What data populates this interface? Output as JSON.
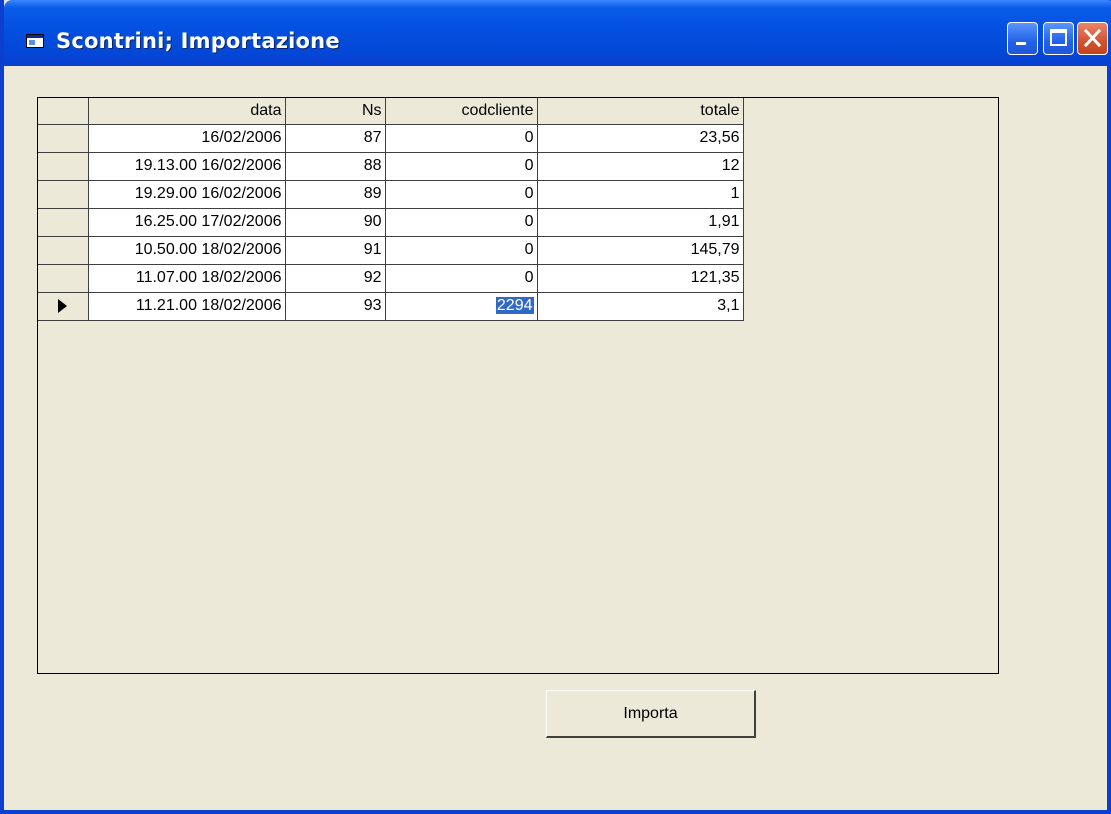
{
  "window": {
    "title": "Scontrini; Importazione"
  },
  "grid": {
    "columns": [
      "",
      "data",
      "Ns",
      "codcliente",
      "totale"
    ],
    "rows": [
      {
        "data": "16/02/2006",
        "ns": "87",
        "codcliente": "0",
        "totale": "23,56",
        "current": false
      },
      {
        "data": "16/02/2006 19.13.00",
        "ns": "88",
        "codcliente": "0",
        "totale": "12",
        "current": false
      },
      {
        "data": "16/02/2006 19.29.00",
        "ns": "89",
        "codcliente": "0",
        "totale": "1",
        "current": false
      },
      {
        "data": "17/02/2006 16.25.00",
        "ns": "90",
        "codcliente": "0",
        "totale": "1,91",
        "current": false
      },
      {
        "data": "18/02/2006 10.50.00",
        "ns": "91",
        "codcliente": "0",
        "totale": "145,79",
        "current": false
      },
      {
        "data": "18/02/2006 11.07.00",
        "ns": "92",
        "codcliente": "0",
        "totale": "121,35",
        "current": false
      },
      {
        "data": "18/02/2006 11.21.00",
        "ns": "93",
        "codcliente": "2294",
        "totale": "3,1",
        "current": true
      }
    ]
  },
  "buttons": {
    "import_label": "Importa"
  },
  "icons": {
    "app": "window-app-icon",
    "minimize": "minimize-icon",
    "maximize": "maximize-icon",
    "close": "close-icon",
    "current_row": "row-pointer-icon"
  },
  "colors": {
    "titlebar": "#0450e0",
    "selection": "#316ac5",
    "face": "#ece9d8",
    "close_button": "#d2532e"
  }
}
